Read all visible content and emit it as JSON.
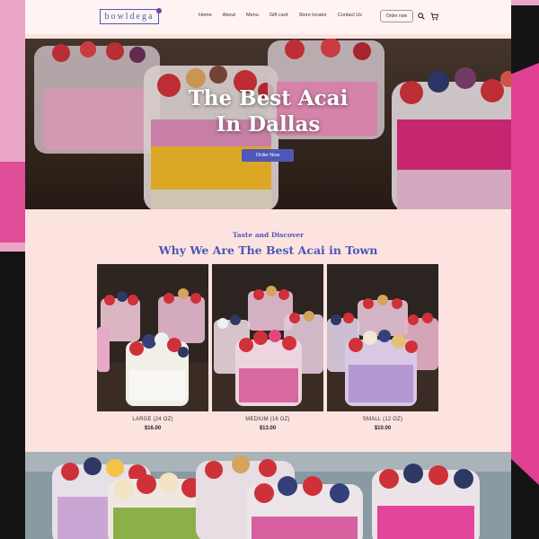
{
  "header": {
    "logo": "bowldega",
    "nav": [
      "Home",
      "About",
      "Menu",
      "Gift card",
      "Store locator",
      "Contact Us"
    ],
    "order_button": "Order now",
    "icons": [
      "search-icon",
      "cart-icon"
    ]
  },
  "hero": {
    "title_line1": "The Best Acai",
    "title_line2": "In Dallas",
    "button": "Order Now"
  },
  "section": {
    "kicker": "Taste and Discover",
    "title": "Why We Are The Best Acai in Town"
  },
  "products": [
    {
      "name": "LARGE (24 OZ)",
      "price": "$16.00"
    },
    {
      "name": "MEDIUM (16 OZ)",
      "price": "$13.00"
    },
    {
      "name": "SMALL (12 OZ)",
      "price": "$10.00"
    }
  ],
  "colors": {
    "accent": "#4d56b8",
    "page_bg": "#fde3df",
    "header_bg": "#fff4f1",
    "magenta": "#e04193"
  }
}
